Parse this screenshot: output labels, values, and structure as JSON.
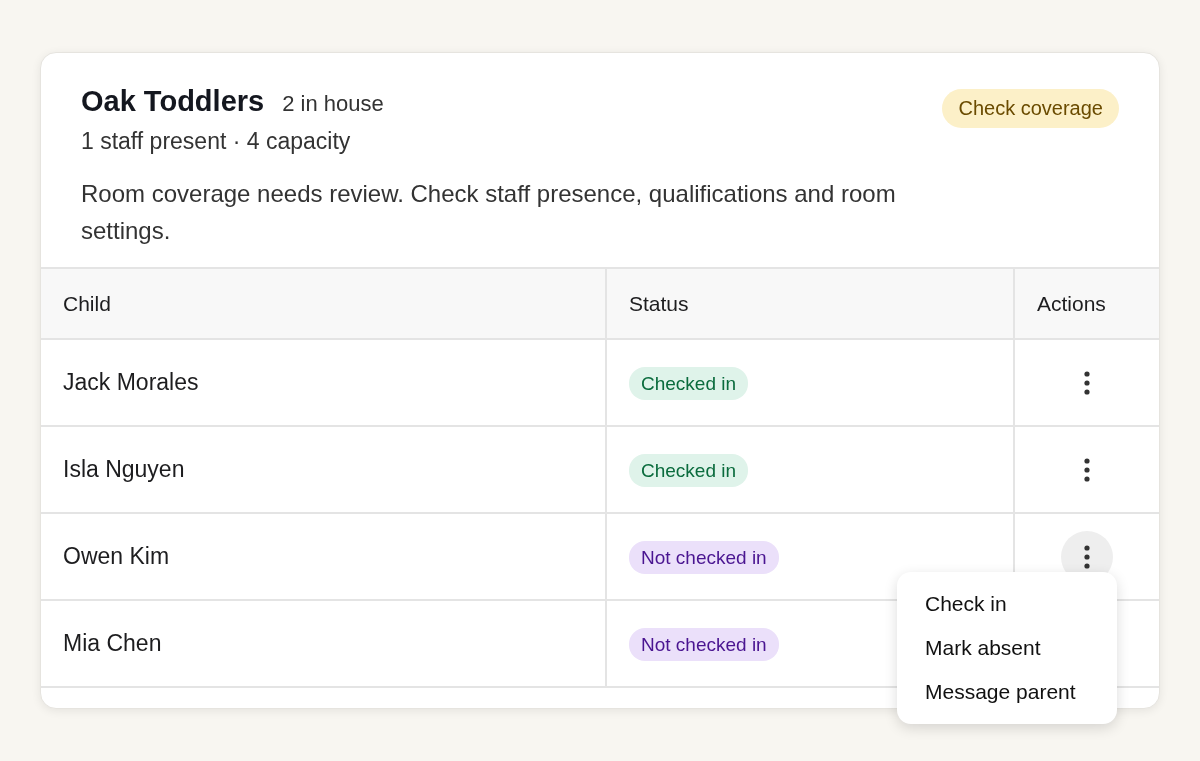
{
  "room": {
    "title": "Oak Toddlers",
    "count": "2 in house",
    "stats": "1 staff present · 4 capacity",
    "alert": "Room coverage needs review. Check staff presence, qualifications and room settings.",
    "badge": "Check coverage"
  },
  "table": {
    "columns": [
      "Child",
      "Status",
      "Actions"
    ],
    "rows": [
      {
        "child": "Jack Morales",
        "status": {
          "kind": "checked_in",
          "label": "Checked in"
        },
        "menu_open": false
      },
      {
        "child": "Isla Nguyen",
        "status": {
          "kind": "checked_in",
          "label": "Checked in"
        },
        "menu_open": false
      },
      {
        "child": "Owen Kim",
        "status": {
          "kind": "not_checked_in",
          "label": "Not checked in"
        },
        "menu_open": true
      },
      {
        "child": "Mia Chen",
        "status": {
          "kind": "not_checked_in",
          "label": "Not checked in"
        },
        "menu_open": false
      }
    ]
  },
  "menu": {
    "items": [
      "Check in",
      "Mark absent",
      "Message parent"
    ]
  }
}
